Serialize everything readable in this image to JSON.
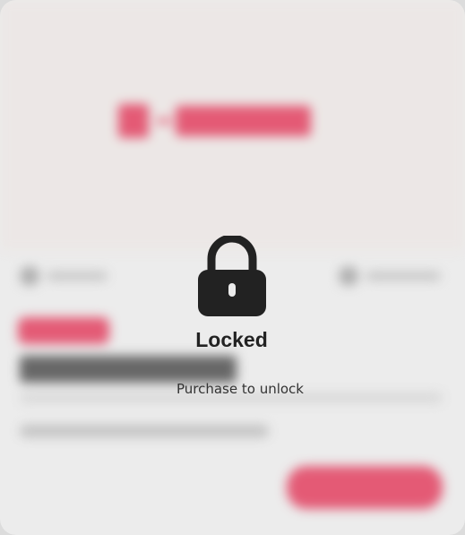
{
  "lock": {
    "icon": "lock-icon",
    "title": "Locked",
    "subtitle": "Purchase to unlock"
  },
  "colors": {
    "accent": "#e0294d",
    "card_background": "#ebebeb",
    "hero_background": "#ebe5e3",
    "lock_color": "#222222"
  }
}
